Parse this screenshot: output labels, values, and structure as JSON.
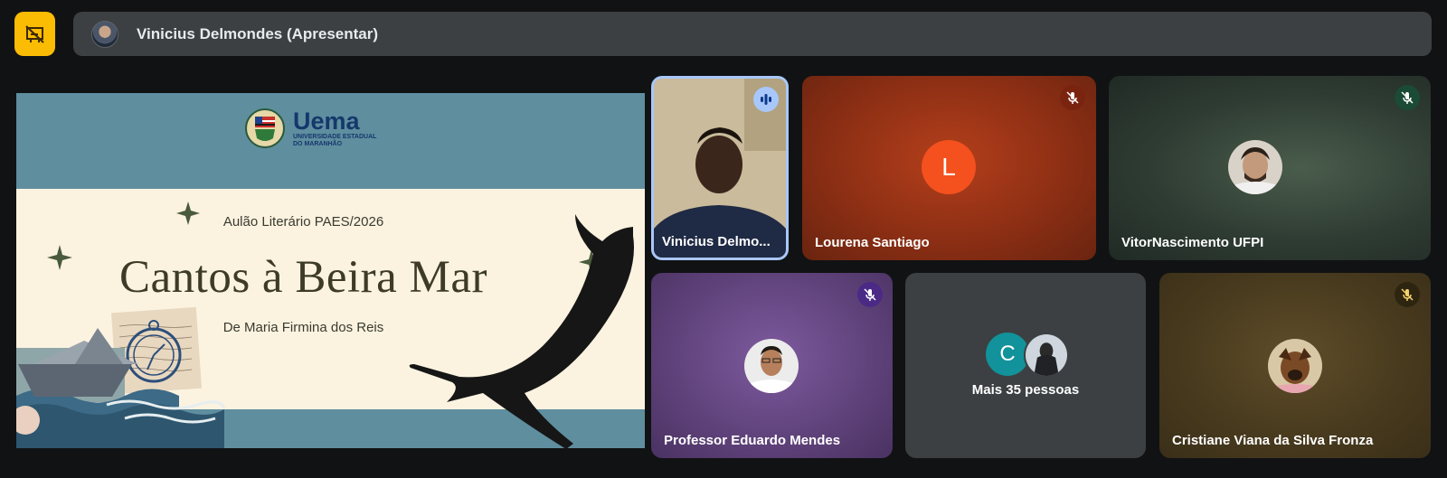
{
  "presenter_bar": {
    "name": "Vinicius Delmondes (Apresentar)",
    "toggle_color": "#fbbc04",
    "toggle_icon": "presentation-off-icon"
  },
  "slide": {
    "logo_name": "Uema",
    "logo_sub_1": "UNIVERSIDADE ESTADUAL",
    "logo_sub_2": "DO MARANHÃO",
    "subtitle": "Aulão Literário PAES/2026",
    "title": "Cantos à Beira Mar",
    "author": "De Maria Firmina dos Reis"
  },
  "participants": [
    {
      "name": "Vinicius Delmo...",
      "state": "speaking",
      "icon": "speaking-indicator-icon",
      "highlight": "#a8c7fa"
    },
    {
      "name": "Lourena Santiago",
      "avatar_letter": "L",
      "avatar_color": "#f4511e",
      "state": "muted",
      "icon": "mic-off-icon"
    },
    {
      "name": "VitorNascimento UFPI",
      "state": "muted",
      "icon": "mic-off-icon"
    },
    {
      "name": "Professor Eduardo Mendes",
      "state": "muted",
      "icon": "mic-off-icon"
    },
    {
      "name": "Mais 35 pessoas",
      "avatar_letter": "C",
      "avatar_color": "#12929a"
    },
    {
      "name": "Cristiane Viana da Silva Fronza",
      "state": "muted",
      "icon": "mic-off-icon"
    }
  ]
}
